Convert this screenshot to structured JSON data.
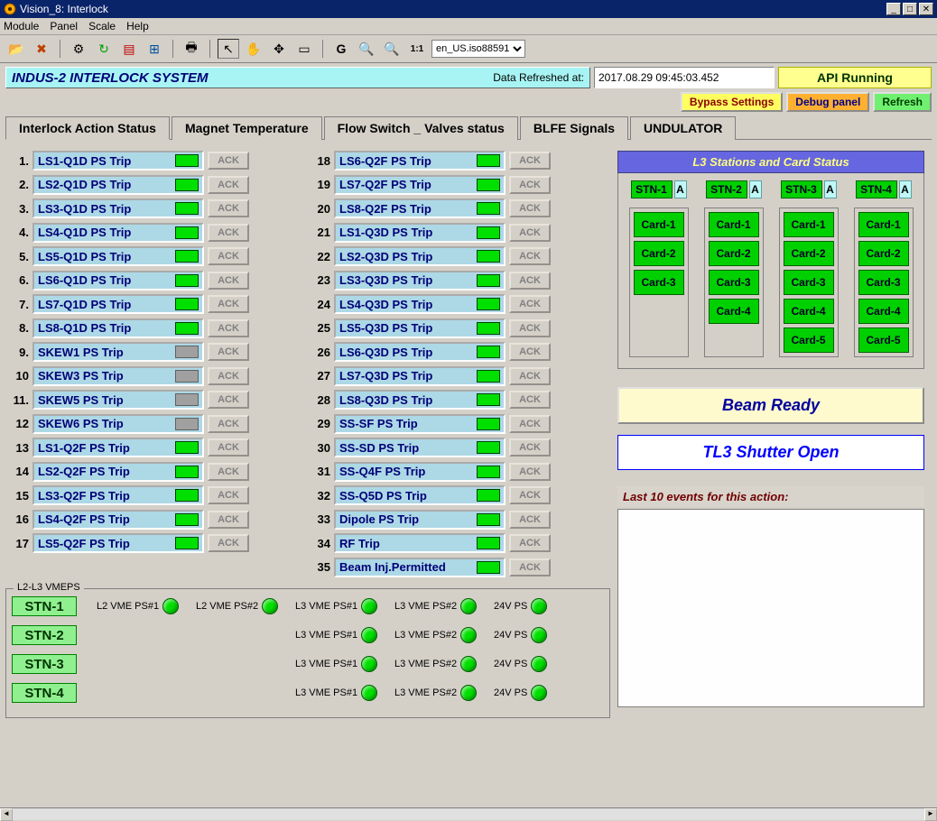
{
  "window": {
    "title": "Vision_8: Interlock",
    "menu": [
      "Module",
      "Panel",
      "Scale",
      "Help"
    ],
    "locale_selector": "en_US.iso88591"
  },
  "header": {
    "system_title": "INDUS-2 INTERLOCK SYSTEM",
    "refreshed_label": "Data Refreshed at:",
    "refreshed_value": "2017.08.29 09:45:03.452",
    "api_status": "API Running",
    "buttons": {
      "bypass": "Bypass Settings",
      "debug": "Debug panel",
      "refresh": "Refresh"
    }
  },
  "tabs": [
    "Interlock Action Status",
    "Magnet Temperature",
    "Flow Switch _ Valves status",
    "BLFE Signals",
    "UNDULATOR"
  ],
  "active_tab": 0,
  "trips_col1": [
    {
      "n": "1.",
      "label": "LS1-Q1D PS Trip",
      "led": "green"
    },
    {
      "n": "2.",
      "label": "LS2-Q1D PS Trip",
      "led": "green"
    },
    {
      "n": "3.",
      "label": "LS3-Q1D PS Trip",
      "led": "green"
    },
    {
      "n": "4.",
      "label": "LS4-Q1D PS Trip",
      "led": "green"
    },
    {
      "n": "5.",
      "label": "LS5-Q1D PS Trip",
      "led": "green"
    },
    {
      "n": "6.",
      "label": "LS6-Q1D PS Trip",
      "led": "green"
    },
    {
      "n": "7.",
      "label": "LS7-Q1D PS Trip",
      "led": "green"
    },
    {
      "n": "8.",
      "label": "LS8-Q1D PS Trip",
      "led": "green"
    },
    {
      "n": "9.",
      "label": "SKEW1 PS Trip",
      "led": "gray"
    },
    {
      "n": "10",
      "label": "SKEW3 PS Trip",
      "led": "gray"
    },
    {
      "n": "11.",
      "label": "SKEW5 PS Trip",
      "led": "gray"
    },
    {
      "n": "12",
      "label": "SKEW6 PS Trip",
      "led": "gray"
    },
    {
      "n": "13",
      "label": "LS1-Q2F PS Trip",
      "led": "green"
    },
    {
      "n": "14",
      "label": "LS2-Q2F PS Trip",
      "led": "green"
    },
    {
      "n": "15",
      "label": "LS3-Q2F PS Trip",
      "led": "green"
    },
    {
      "n": "16",
      "label": "LS4-Q2F PS Trip",
      "led": "green"
    },
    {
      "n": "17",
      "label": "LS5-Q2F PS Trip",
      "led": "green"
    }
  ],
  "trips_col2": [
    {
      "n": "18",
      "label": "LS6-Q2F PS Trip",
      "led": "green"
    },
    {
      "n": "19",
      "label": "LS7-Q2F PS Trip",
      "led": "green"
    },
    {
      "n": "20",
      "label": "LS8-Q2F PS Trip",
      "led": "green"
    },
    {
      "n": "21",
      "label": "LS1-Q3D PS Trip",
      "led": "green"
    },
    {
      "n": "22",
      "label": "LS2-Q3D PS Trip",
      "led": "green"
    },
    {
      "n": "23",
      "label": "LS3-Q3D PS Trip",
      "led": "green"
    },
    {
      "n": "24",
      "label": "LS4-Q3D PS Trip",
      "led": "green"
    },
    {
      "n": "25",
      "label": "LS5-Q3D PS Trip",
      "led": "green"
    },
    {
      "n": "26",
      "label": "LS6-Q3D PS Trip",
      "led": "green"
    },
    {
      "n": "27",
      "label": "LS7-Q3D PS Trip",
      "led": "green"
    },
    {
      "n": "28",
      "label": "LS8-Q3D PS Trip",
      "led": "green"
    },
    {
      "n": "29",
      "label": "SS-SF PS Trip",
      "led": "green"
    },
    {
      "n": "30",
      "label": "SS-SD PS Trip",
      "led": "green"
    },
    {
      "n": "31",
      "label": "SS-Q4F PS Trip",
      "led": "green"
    },
    {
      "n": "32",
      "label": "SS-Q5D PS Trip",
      "led": "green"
    },
    {
      "n": "33",
      "label": "Dipole PS Trip",
      "led": "green"
    },
    {
      "n": "34",
      "label": "RF Trip",
      "led": "green"
    },
    {
      "n": "35",
      "label": "Beam Inj.Permitted",
      "led": "green"
    }
  ],
  "ack_label": "ACK",
  "vmeps": {
    "title": "L2-L3 VMEPS",
    "rows": [
      {
        "stn": "STN-1",
        "cells": [
          "L2 VME PS#1",
          "L2 VME PS#2",
          "L3 VME PS#1",
          "L3 VME PS#2",
          "24V PS"
        ]
      },
      {
        "stn": "STN-2",
        "cells": [
          "",
          "",
          "L3 VME PS#1",
          "L3 VME PS#2",
          "24V PS"
        ]
      },
      {
        "stn": "STN-3",
        "cells": [
          "",
          "",
          "L3 VME PS#1",
          "L3 VME PS#2",
          "24V PS"
        ]
      },
      {
        "stn": "STN-4",
        "cells": [
          "",
          "",
          "L3 VME PS#1",
          "L3 VME PS#2",
          "24V PS"
        ]
      }
    ]
  },
  "l3_status": {
    "title": "L3 Stations and Card Status",
    "stations": [
      {
        "name": "STN-1",
        "ab": "A",
        "cards": [
          "Card-1",
          "Card-2",
          "Card-3"
        ]
      },
      {
        "name": "STN-2",
        "ab": "A",
        "cards": [
          "Card-1",
          "Card-2",
          "Card-3",
          "Card-4"
        ]
      },
      {
        "name": "STN-3",
        "ab": "A",
        "cards": [
          "Card-1",
          "Card-2",
          "Card-3",
          "Card-4",
          "Card-5"
        ]
      },
      {
        "name": "STN-4",
        "ab": "A",
        "cards": [
          "Card-1",
          "Card-2",
          "Card-3",
          "Card-4",
          "Card-5"
        ]
      }
    ]
  },
  "beam_ready": "Beam Ready",
  "shutter": "TL3 Shutter Open",
  "events_label": "Last 10 events for this action:",
  "toolbar_icons": [
    "folder-open",
    "close",
    "gear",
    "history",
    "layers",
    "tree",
    "print",
    "cursor",
    "hand",
    "move",
    "rect",
    "G",
    "zoom-in",
    "zoom-out",
    "1:1"
  ]
}
